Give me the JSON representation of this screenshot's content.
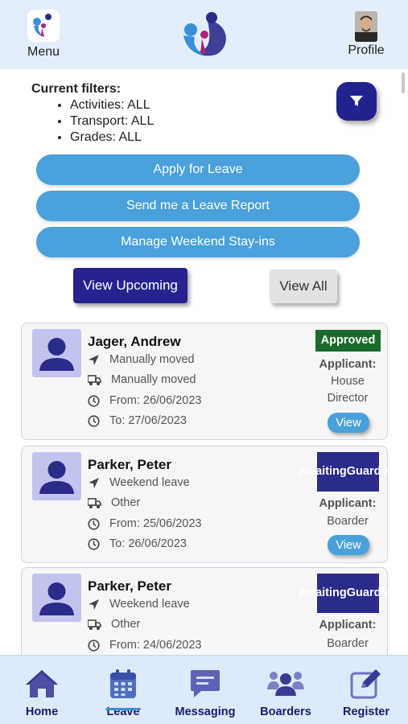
{
  "header": {
    "menu_label": "Menu",
    "profile_label": "Profile"
  },
  "filters": {
    "title": "Current filters:",
    "items": [
      "Activities: ALL",
      "Transport: ALL",
      "Grades: ALL"
    ]
  },
  "actions": {
    "apply_leave": "Apply for Leave",
    "leave_report": "Send me a Leave Report",
    "weekend_stayins": "Manage Weekend Stay-ins"
  },
  "view_toggle": {
    "upcoming": "View Upcoming",
    "all": "View All"
  },
  "leave_cards": [
    {
      "name": "Jager, Andrew",
      "destination": "Manually moved",
      "transport": "Manually moved",
      "from": "From: 26/06/2023",
      "to": "To: 27/06/2023",
      "status": "Approved",
      "applicant_label": "Applicant:",
      "applicant_line1": "House",
      "applicant_line2": "Director",
      "view_label": "View"
    },
    {
      "name": "Parker, Peter",
      "destination": "Weekend leave",
      "transport": "Other",
      "from": "From: 25/06/2023",
      "to": "To: 26/06/2023",
      "status_line1": "Awaiting",
      "status_line2": "Guardian",
      "applicant_label": "Applicant:",
      "applicant": "Boarder",
      "view_label": "View"
    },
    {
      "name": "Parker, Peter",
      "destination": "Weekend leave",
      "transport": "Other",
      "from": "From: 24/06/2023",
      "status_line1": "Awaiting",
      "status_line2": "Guardian",
      "applicant_label": "Applicant:",
      "applicant": "Boarder"
    }
  ],
  "nav": {
    "home": "Home",
    "leave": "Leave",
    "messaging": "Messaging",
    "boarders": "Boarders",
    "register": "Register",
    "active": "leave"
  },
  "colors": {
    "primary_dark": "#26238f",
    "accent_blue": "#4aa1dc",
    "approved_green": "#1a6b2e",
    "awaiting_navy": "#2b2b8a",
    "nav_text": "#1b1b6b"
  },
  "icons": [
    "filter-icon",
    "location-arrow-icon",
    "truck-icon",
    "clock-icon",
    "user-avatar-icon",
    "home-icon",
    "calendar-icon",
    "message-icon",
    "users-icon",
    "edit-icon"
  ]
}
